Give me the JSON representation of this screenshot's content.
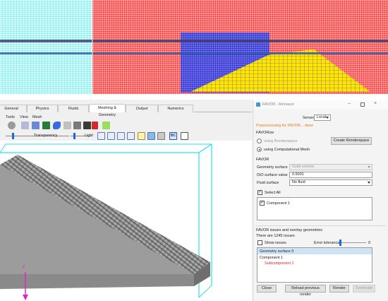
{
  "main_window": {
    "tabs": [
      {
        "label": "General"
      },
      {
        "label": "Physics"
      },
      {
        "label": "Fluids"
      },
      {
        "label": "Meshing & Geometry"
      },
      {
        "label": "Output"
      },
      {
        "label": "Numerics"
      }
    ],
    "active_tab": "Meshing & Geometry",
    "menus": [
      {
        "label": "Tools"
      },
      {
        "label": "View"
      },
      {
        "label": "Mesh"
      }
    ],
    "transparency_label": "Transparency",
    "light_label": "Light",
    "bc_label": "BC",
    "axis_label": "Z"
  },
  "dialog": {
    "title": "FAVOR - Airmauor",
    "server_label": "Server",
    "server_value": "Local",
    "status_text": "Preprocessing for FAVOR... done",
    "favorize_header": "FAVORize",
    "option_renderspace": "using Renderspace",
    "option_computational": "using Computational Mesh",
    "selected_option": "using Computational Mesh",
    "create_renderspace_button": "Create Renderspace",
    "favor_header": "FAVOR",
    "geometry_surface_label": "Geometry surface",
    "geometry_surface_value": "Solid volume",
    "iso_surface_label": "ISO surface value",
    "iso_surface_value": "0.5001",
    "fluid_surface_label": "Fluid surface",
    "fluid_surface_value": "No fluid",
    "select_all_label": "Select All",
    "select_all_checked": true,
    "components": [
      {
        "label": "Component 1",
        "checked": true
      }
    ],
    "issues_header": "FAVOR issues and overlay geometries",
    "issues_count_text": "There are 1245 issues",
    "show_issues_label": "Show issues",
    "show_issues_checked": false,
    "error_tolerance_label": "Error tolerance",
    "error_tolerance_value": "0",
    "overlay_tree": [
      {
        "label": "Geometry surface 0",
        "color": "#1a1a1a"
      },
      {
        "label": "Component 1",
        "color": "#1a1a1a"
      },
      {
        "label": "Subcomponent 1",
        "color": "#d42020"
      }
    ],
    "buttons": {
      "close": "Close",
      "reload": "Reload previous render",
      "render": "Render",
      "terminate": "Terminate"
    }
  },
  "colors": {
    "mesh_red": "#ff1a1a",
    "mesh_cyan": "#5ff0f0",
    "mesh_blue": "#2b2bd6",
    "surface_yellow": "#ffe600",
    "status_orange": "#e07a16",
    "slope_gray": "#8c8c8c",
    "axis_magenta": "#e020c8"
  }
}
